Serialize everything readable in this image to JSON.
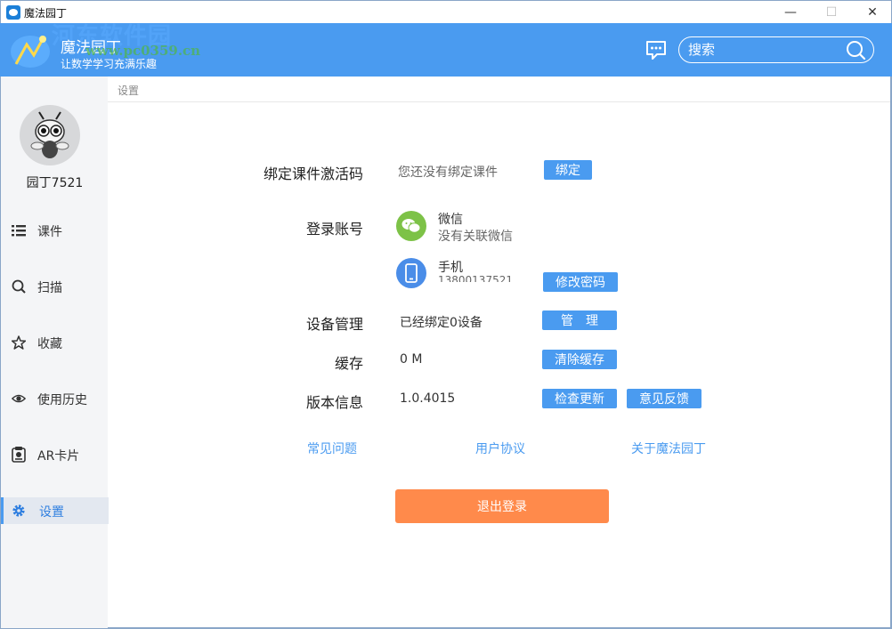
{
  "window": {
    "title": "魔法园丁",
    "minimize": "—",
    "maximize": "☐",
    "close": "✕"
  },
  "header": {
    "app_name": "魔法园丁",
    "slogan": "让数学学习充满乐趣",
    "watermark": "河东软件园",
    "watermark_url": "www.pc0359.cn",
    "search_placeholder": "搜索",
    "icons": {
      "message": "chat-bubble-icon",
      "search": "search-icon"
    }
  },
  "sidebar": {
    "username": "园丁7521",
    "items": [
      {
        "label": "课件",
        "icon": "list-icon"
      },
      {
        "label": "扫描",
        "icon": "search-icon"
      },
      {
        "label": "收藏",
        "icon": "star-icon"
      },
      {
        "label": "使用历史",
        "icon": "eye-icon"
      },
      {
        "label": "AR卡片",
        "icon": "ar-card-icon"
      },
      {
        "label": "设置",
        "icon": "gear-icon",
        "active": true
      }
    ]
  },
  "breadcrumb": "设置",
  "settings": {
    "activation": {
      "label": "绑定课件激活码",
      "value": "您还没有绑定课件",
      "button": "绑定"
    },
    "account": {
      "label": "登录账号",
      "wechat_title": "微信",
      "wechat_value": "没有关联微信",
      "phone_title": "手机",
      "phone_value": "13800137521",
      "button": "修改密码"
    },
    "device": {
      "label": "设备管理",
      "value": "已经绑定0设备",
      "button": "管　理"
    },
    "cache": {
      "label": "缓存",
      "value": "0 M",
      "button": "清除缓存"
    },
    "version": {
      "label": "版本信息",
      "value": "1.0.4015",
      "button_update": "检查更新",
      "button_feedback": "意见反馈"
    }
  },
  "links": {
    "faq": "常见问题",
    "agreement": "用户协议",
    "about": "关于魔法园丁"
  },
  "logout": "退出登录",
  "colors": {
    "accent": "#4a9bf0",
    "logout": "#ff8a4b",
    "wechat": "#7dc247",
    "phone": "#4a8de8"
  }
}
